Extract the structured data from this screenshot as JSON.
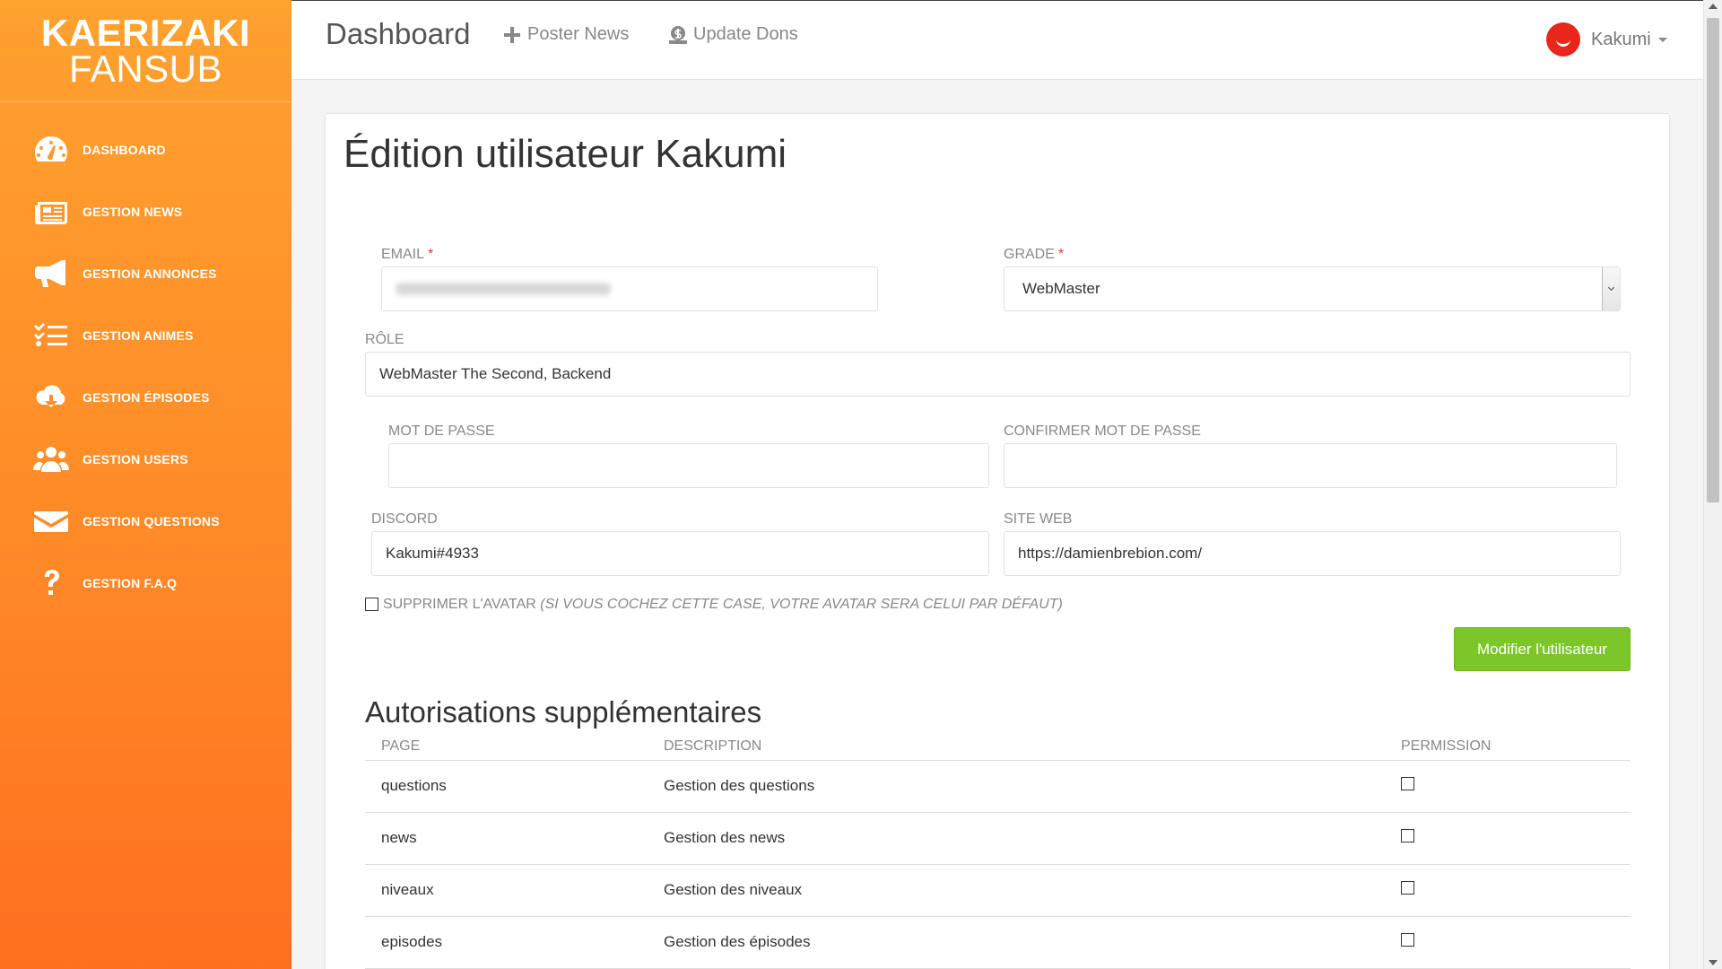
{
  "brand": {
    "line1": "KAERIZAKI",
    "line2": "FANSUB"
  },
  "sidebar": {
    "items": [
      {
        "label": "DASHBOARD",
        "icon": "dashboard-gauge-icon"
      },
      {
        "label": "GESTION NEWS",
        "icon": "newspaper-icon"
      },
      {
        "label": "GESTION ANNONCES",
        "icon": "megaphone-icon"
      },
      {
        "label": "GESTION ANIMES",
        "icon": "checklist-icon"
      },
      {
        "label": "GESTION ÉPISODES",
        "icon": "cloud-download-icon"
      },
      {
        "label": "GESTION USERS",
        "icon": "users-icon"
      },
      {
        "label": "GESTION QUESTIONS",
        "icon": "envelope-icon"
      },
      {
        "label": "GESTION F.A.Q",
        "icon": "question-mark-icon"
      }
    ]
  },
  "topbar": {
    "title": "Dashboard",
    "links": [
      {
        "label": "Poster News",
        "icon": "plus-icon"
      },
      {
        "label": "Update Dons",
        "icon": "money-icon"
      }
    ],
    "user": {
      "name": "Kakumi"
    }
  },
  "form": {
    "title": "Édition utilisateur Kakumi",
    "email_label": "EMAIL",
    "grade_label": "GRADE",
    "grade_value": "WebMaster",
    "role_label": "RÔLE",
    "role_value": "WebMaster The Second, Backend",
    "password_label": "MOT DE PASSE",
    "confirm_password_label": "CONFIRMER MOT DE PASSE",
    "discord_label": "DISCORD",
    "discord_value": "Kakumi#4933",
    "website_label": "SITE WEB",
    "website_value": "https://damienbrebion.com/",
    "delete_avatar_label": "SUPPRIMER L'AVATAR",
    "delete_avatar_hint": "(SI VOUS COCHEZ CETTE CASE, VOTRE AVATAR SERA CELUI PAR DÉFAUT)",
    "submit_label": "Modifier l'utilisateur",
    "required_mark": "*"
  },
  "permissions": {
    "title": "Autorisations supplémentaires",
    "headers": {
      "page": "PAGE",
      "description": "DESCRIPTION",
      "permission": "PERMISSION"
    },
    "rows": [
      {
        "page": "questions",
        "description": "Gestion des questions"
      },
      {
        "page": "news",
        "description": "Gestion des news"
      },
      {
        "page": "niveaux",
        "description": "Gestion des niveaux"
      },
      {
        "page": "episodes",
        "description": "Gestion des épisodes"
      }
    ]
  },
  "colors": {
    "sidebar_top": "#ffa22e",
    "sidebar_bottom": "#ff6f20",
    "button_green": "#7cc629",
    "required_red": "#e53935",
    "avatar_red": "#e8261c"
  }
}
